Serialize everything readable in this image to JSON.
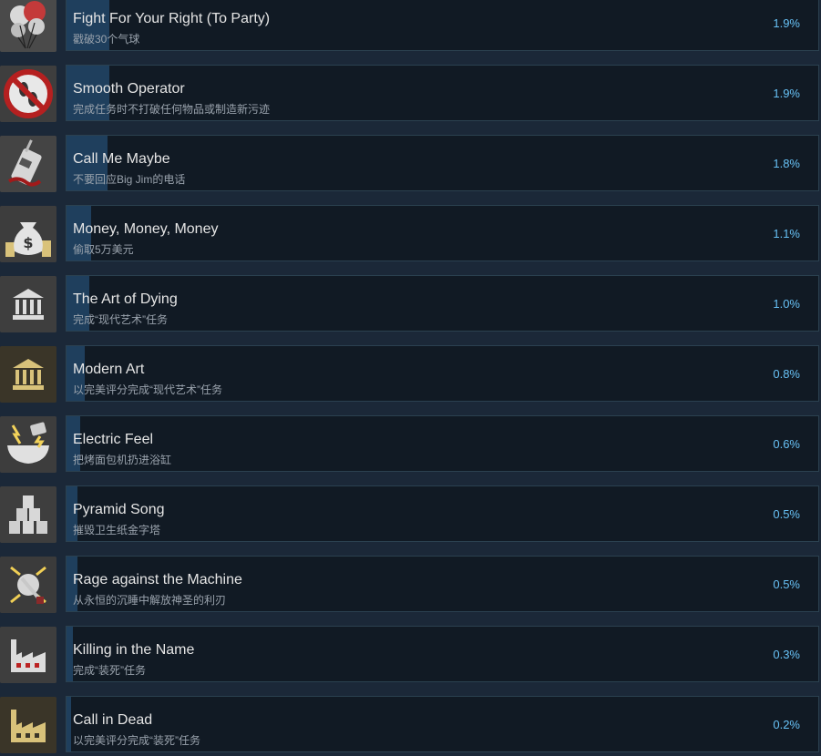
{
  "achievements": [
    {
      "title": "Fight For Your Right (To Party)",
      "description": "戳破30个气球",
      "percent": "1.9%",
      "icon": "balloons-icon",
      "unlock_fraction": 0.019
    },
    {
      "title": "Smooth Operator",
      "description": "完成任务时不打破任何物品或制造新污迹",
      "percent": "1.9%",
      "icon": "no-footprints-icon",
      "unlock_fraction": 0.019
    },
    {
      "title": "Call Me Maybe",
      "description": "不要回应Big Jim的电话",
      "percent": "1.8%",
      "icon": "walkie-talkie-icon",
      "unlock_fraction": 0.018
    },
    {
      "title": "Money, Money, Money",
      "description": "偷取5万美元",
      "percent": "1.1%",
      "icon": "money-bag-icon",
      "unlock_fraction": 0.011
    },
    {
      "title": "The Art of Dying",
      "description": "完成“现代艺术”任务",
      "percent": "1.0%",
      "icon": "museum-icon",
      "unlock_fraction": 0.01
    },
    {
      "title": "Modern Art",
      "description": "以完美评分完成“现代艺术”任务",
      "percent": "0.8%",
      "icon": "museum-gold-icon",
      "unlock_fraction": 0.008
    },
    {
      "title": "Electric Feel",
      "description": "把烤面包机扔进浴缸",
      "percent": "0.6%",
      "icon": "bathtub-toaster-icon",
      "unlock_fraction": 0.006
    },
    {
      "title": "Pyramid Song",
      "description": "摧毁卫生纸金字塔",
      "percent": "0.5%",
      "icon": "toilet-paper-pyramid-icon",
      "unlock_fraction": 0.005
    },
    {
      "title": "Rage against the Machine",
      "description": "从永恒的沉睡中解放神圣的利刃",
      "percent": "0.5%",
      "icon": "broken-machine-icon",
      "unlock_fraction": 0.005
    },
    {
      "title": "Killing in the Name",
      "description": "完成“装死”任务",
      "percent": "0.3%",
      "icon": "factory-icon",
      "unlock_fraction": 0.003
    },
    {
      "title": "Call in Dead",
      "description": "以完美评分完成“装死”任务",
      "percent": "0.2%",
      "icon": "factory-gold-icon",
      "unlock_fraction": 0.002
    }
  ]
}
